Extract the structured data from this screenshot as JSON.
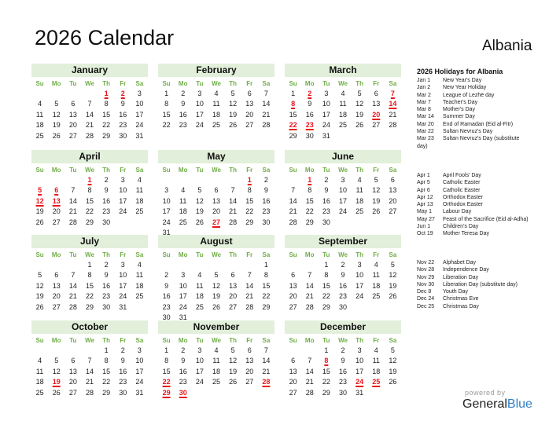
{
  "header": {
    "title": "2026 Calendar",
    "country": "Albania"
  },
  "weekdays": [
    "Su",
    "Mo",
    "Tu",
    "We",
    "Th",
    "Fr",
    "Sa"
  ],
  "year": 2026,
  "months": [
    {
      "name": "January",
      "start": 4,
      "days": 31,
      "holidays": [
        1,
        2
      ]
    },
    {
      "name": "February",
      "start": 0,
      "days": 28,
      "holidays": []
    },
    {
      "name": "March",
      "start": 0,
      "days": 31,
      "holidays": [
        2,
        7,
        8,
        14,
        20,
        22,
        23
      ]
    },
    {
      "name": "April",
      "start": 3,
      "days": 30,
      "holidays": [
        1,
        5,
        6,
        12,
        13
      ]
    },
    {
      "name": "May",
      "start": 5,
      "days": 31,
      "holidays": [
        1,
        27
      ]
    },
    {
      "name": "June",
      "start": 1,
      "days": 30,
      "holidays": [
        1
      ]
    },
    {
      "name": "July",
      "start": 3,
      "days": 31,
      "holidays": []
    },
    {
      "name": "August",
      "start": 6,
      "days": 31,
      "holidays": []
    },
    {
      "name": "September",
      "start": 2,
      "days": 30,
      "holidays": []
    },
    {
      "name": "October",
      "start": 4,
      "days": 31,
      "holidays": [
        19
      ]
    },
    {
      "name": "November",
      "start": 0,
      "days": 30,
      "holidays": [
        22,
        28,
        29,
        30
      ]
    },
    {
      "name": "December",
      "start": 2,
      "days": 31,
      "holidays": [
        8,
        24,
        25
      ]
    }
  ],
  "holidays_panel": {
    "title": "2026 Holidays for Albania",
    "groups": [
      [
        {
          "date": "Jan 1",
          "name": "New Year's Day"
        },
        {
          "date": "Jan 2",
          "name": "New Year Holiday"
        },
        {
          "date": "Mar 2",
          "name": "League of Lezhë day"
        },
        {
          "date": "Mar 7",
          "name": "Teacher's Day"
        },
        {
          "date": "Mar 8",
          "name": "Mother's Day"
        },
        {
          "date": "Mar 14",
          "name": "Summer Day"
        },
        {
          "date": "Mar 20",
          "name": "End of Ramadan (Eid al-Fitr)"
        },
        {
          "date": "Mar 22",
          "name": "Sultan Nevruz's Day"
        },
        {
          "date": "Mar 23",
          "name": "Sultan Nevruz's Day (substitute day)"
        }
      ],
      [
        {
          "date": "Apr 1",
          "name": "April Fools' Day"
        },
        {
          "date": "Apr 5",
          "name": "Catholic Easter"
        },
        {
          "date": "Apr 6",
          "name": "Catholic Easter"
        },
        {
          "date": "Apr 12",
          "name": "Orthodox Easter"
        },
        {
          "date": "Apr 13",
          "name": "Orthodox Easter"
        },
        {
          "date": "May 1",
          "name": "Labour Day"
        },
        {
          "date": "May 27",
          "name": "Feast of the Sacrifice (Eid al-Adha)"
        },
        {
          "date": "Jun 1",
          "name": "Children's Day"
        },
        {
          "date": "Oct 19",
          "name": "Mother Teresa Day"
        }
      ],
      [
        {
          "date": "Nov 22",
          "name": "Alphabet Day"
        },
        {
          "date": "Nov 28",
          "name": "Independence Day"
        },
        {
          "date": "Nov 29",
          "name": "Liberation Day"
        },
        {
          "date": "Nov 30",
          "name": "Liberation Day (substitute day)"
        },
        {
          "date": "Dec 8",
          "name": "Youth Day"
        },
        {
          "date": "Dec 24",
          "name": "Christmas Eve"
        },
        {
          "date": "Dec 25",
          "name": "Christmas Day"
        }
      ]
    ]
  },
  "footer": {
    "powered_by": "powered by",
    "brand_general": "General",
    "brand_blue": "Blue"
  },
  "colors": {
    "header_bg": "#e2efda",
    "weekday": "#70ad47",
    "holiday": "#e8141c",
    "brand_blue": "#2f7fc4"
  }
}
